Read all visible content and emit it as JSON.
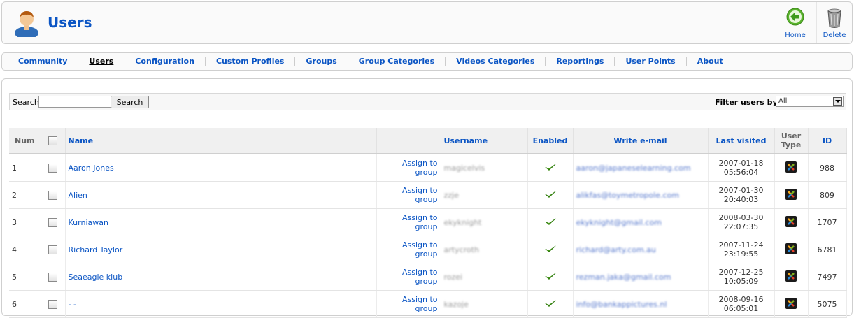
{
  "header": {
    "title": "Users",
    "toolbar": [
      {
        "label": "Home",
        "icon": "home-arrow-icon"
      },
      {
        "label": "Delete",
        "icon": "trash-icon"
      }
    ]
  },
  "tabs": [
    {
      "label": "Community",
      "active": false
    },
    {
      "label": "Users",
      "active": true
    },
    {
      "label": "Configuration",
      "active": false
    },
    {
      "label": "Custom Profiles",
      "active": false
    },
    {
      "label": "Groups",
      "active": false
    },
    {
      "label": "Group Categories",
      "active": false
    },
    {
      "label": "Videos Categories",
      "active": false
    },
    {
      "label": "Reportings",
      "active": false
    },
    {
      "label": "User Points",
      "active": false
    },
    {
      "label": "About",
      "active": false
    }
  ],
  "filter": {
    "search_label": "Search",
    "search_value": "",
    "search_button": "Search",
    "filter_label": "Filter users by:",
    "filter_selected": "All"
  },
  "table": {
    "columns": {
      "num": "Num",
      "name": "Name",
      "username": "Username",
      "enabled": "Enabled",
      "email": "Write e-mail",
      "last_visited": "Last visited",
      "user_type_1": "User",
      "user_type_2": "Type",
      "id": "ID"
    },
    "assign_label": "Assign to group",
    "rows": [
      {
        "num": "1",
        "name": "Aaron Jones",
        "username": "magicelvis",
        "email": "aaron@japaneselearning.com",
        "date": "2007-01-18",
        "time": "05:56:04",
        "id": "988"
      },
      {
        "num": "2",
        "name": "Alien",
        "username": "zzje",
        "email": "alikfas@toymetropole.com",
        "date": "2007-01-30",
        "time": "20:40:03",
        "id": "809"
      },
      {
        "num": "3",
        "name": "Kurniawan",
        "username": "ekyknight",
        "email": "ekyknight@gmail.com",
        "date": "2008-03-30",
        "time": "22:07:35",
        "id": "1707"
      },
      {
        "num": "4",
        "name": "Richard Taylor",
        "username": "artycroth",
        "email": "richard@arty.com.au",
        "date": "2007-11-24",
        "time": "23:19:55",
        "id": "6781"
      },
      {
        "num": "5",
        "name": "Seaeagle klub",
        "username": "rozei",
        "email": "rezman.jaka@gmail.com",
        "date": "2007-12-25",
        "time": "10:05:09",
        "id": "7497"
      },
      {
        "num": "6",
        "name": "- -",
        "username": "kazoje",
        "email": "info@bankappictures.nl",
        "date": "2008-09-16",
        "time": "06:05:01",
        "id": "5075"
      }
    ]
  },
  "colors": {
    "link": "#0b55c4",
    "enabled_check": "#4a9a1a",
    "home_icon": "#59b32c"
  }
}
